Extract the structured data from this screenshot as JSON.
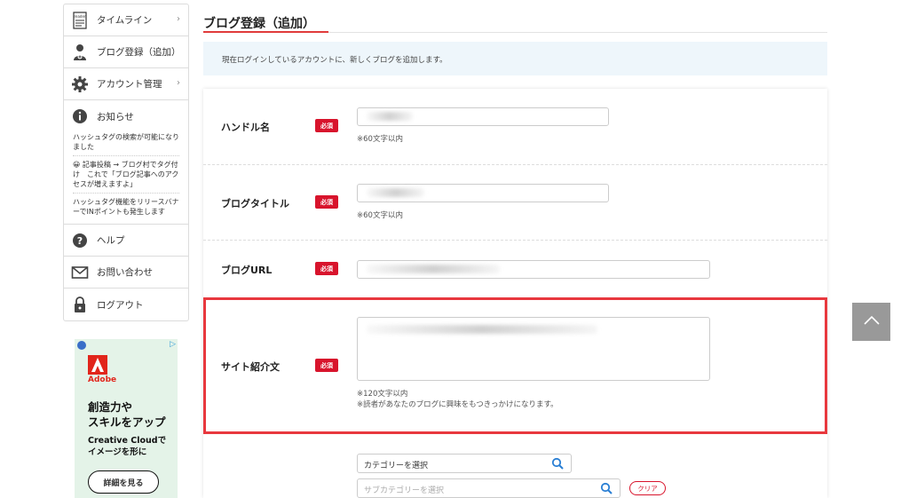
{
  "sidebar": {
    "items": [
      {
        "label": "タイムライン",
        "icon": "reader-icon",
        "has_chevron": true
      },
      {
        "label": "ブログ登録（追加）",
        "icon": "user-add-icon",
        "has_chevron": false
      },
      {
        "label": "アカウント管理",
        "icon": "gear-icon",
        "has_chevron": true
      }
    ],
    "news": {
      "title": "お知らせ",
      "icon": "info-icon",
      "items": [
        "ハッシュタグの検索が可能になりました",
        "😀 記事投稿 → ブログ村でタグ付け　これで「ブログ記事へのアクセスが増えますよ」",
        "ハッシュタグ機能をリリースバナーでINポイントも発生します"
      ]
    },
    "bottom_items": [
      {
        "label": "ヘルプ",
        "icon": "help-icon"
      },
      {
        "label": "お問い合わせ",
        "icon": "mail-icon"
      },
      {
        "label": "ログアウト",
        "icon": "lock-icon"
      }
    ]
  },
  "ad": {
    "brand": "Adobe",
    "headline_1": "創造力や",
    "headline_2": "スキルをアップ",
    "sub_1": "Creative Cloudで",
    "sub_2": "イメージを形に",
    "cta": "詳細を見る"
  },
  "main": {
    "title": "ブログ登録（追加）",
    "info": "現在ログインしているアカウントに、新しくブログを追加します。",
    "required_label": "必須",
    "fields": {
      "handle": {
        "label": "ハンドル名",
        "hint": "※60文字以内"
      },
      "blog_title": {
        "label": "ブログタイトル",
        "hint": "※60文字以内"
      },
      "blog_url": {
        "label": "ブログURL"
      },
      "site_intro": {
        "label": "サイト紹介文",
        "hint_1": "※120文字以内",
        "hint_2": "※読者があなたのブログに興味をもつきっかけになります。"
      }
    },
    "category": {
      "value": "カテゴリーを選択",
      "sub_placeholder": "サブカテゴリーを選択",
      "clear": "クリア"
    }
  },
  "colors": {
    "accent_red": "#d8142c",
    "highlight_red": "#e8383e",
    "info_bg": "#eef6fb",
    "search_blue": "#2a7fd4"
  }
}
